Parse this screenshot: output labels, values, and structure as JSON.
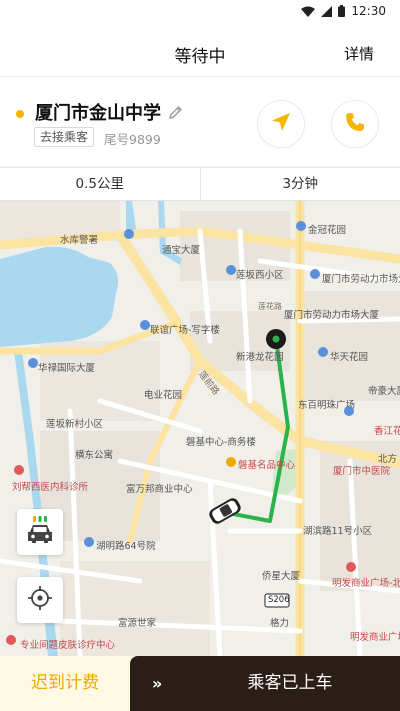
{
  "status_bar": {
    "time": "12:30",
    "icons": [
      "wifi-icon",
      "cellular-signal-icon",
      "battery-icon"
    ]
  },
  "header": {
    "title": "等待中",
    "detail_label": "详情"
  },
  "order": {
    "destination": "厦门市金山中学",
    "tag": "去接乘客",
    "phone_tail": "尾号9899",
    "icons": [
      "edit-icon",
      "navigate-icon",
      "phone-icon"
    ]
  },
  "stats": {
    "distance": "0.5公里",
    "time": "3分钟"
  },
  "map": {
    "labels": {
      "shuiku": "水库警署",
      "tongbao": "通宝大厦",
      "jinguan": "金冠花园",
      "lianbanxi": "莲坂西小区",
      "laodong1": "厦门市劳动力市场大厦",
      "laodong2": "厦门市劳动力市场大厦",
      "lianhua": "莲花路",
      "lianyi": "联谊广场-写字楼",
      "hualu": "华禄国际大厦",
      "xingang": "新港龙花园",
      "huatian": "华天花园",
      "dianye": "电业花园",
      "lianpan_road": "莲前路",
      "dongbaiming": "东百明珠广场",
      "dipu": "帝豪大厦",
      "lianxincun": "莲坂新村小区",
      "xiangjiang": "香江花",
      "binhai": "横东公寓",
      "panji": "磐基中心-商务楼",
      "panji_mall": "磐基名品中心",
      "beifang": "北方",
      "xiamen_hosp": "厦门市中医院",
      "fubang": "富万邦商业中心",
      "hushan_hosp": "刘帮西医内科诊所",
      "hubin": "湖明路64号院",
      "hubin11": "湖滨路11号小区",
      "qiaoxing": "侨星大厦",
      "mingfa_mall": "明发商业广场-北",
      "fuyuan": "富源世家",
      "road_s206": "S206",
      "geli": "格力",
      "zhuanye": "专业间题皮肤诊疗中心",
      "mingfa": "明发商业广场"
    }
  },
  "bottom": {
    "late_fee_label": "迟到计费",
    "slider_arrow": "»",
    "slider_label": "乘客已上车"
  }
}
